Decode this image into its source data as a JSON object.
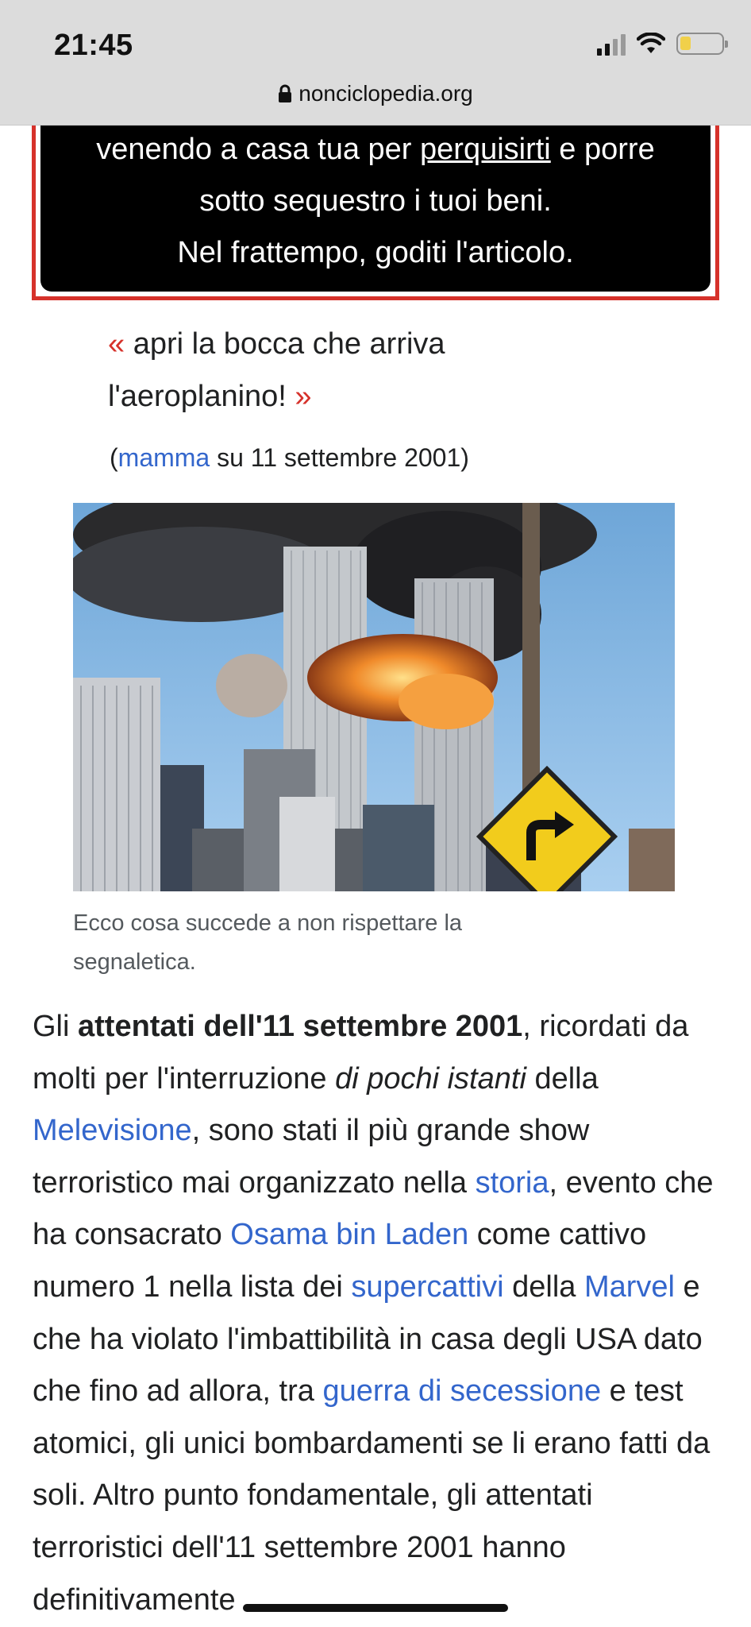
{
  "status_bar": {
    "time": "21:45"
  },
  "url_bar": {
    "domain": "nonciclopedia.org"
  },
  "warning": {
    "line1_before": "venendo a casa tua per ",
    "line1_link": "perquisirti",
    "line1_after": " e porre",
    "line2": "sotto sequestro i tuoi beni.",
    "line3": "Nel frattempo, goditi l'articolo."
  },
  "quote": {
    "open_mark": "«",
    "text": " apri la bocca che arriva l'aeroplanino! ",
    "close_mark": "»",
    "attr_open": "(",
    "attr_link": "mamma",
    "attr_rest": " su 11 settembre 2001)"
  },
  "figure": {
    "caption": "Ecco cosa succede a non rispettare la segnaletica."
  },
  "article": {
    "p1": "Gli ",
    "bold1": "attentati dell'11 settembre 2001",
    "p2": ", ricordati da molti per l'interruzione ",
    "italic1": "di pochi istanti",
    "p3": " della ",
    "link1": "Melevisione",
    "p4": ", sono stati il più grande show terroristico mai organizzato nella ",
    "link2": "storia",
    "p5": ", evento che ha consacrato ",
    "link3": "Osama bin Laden",
    "p6": " come cattivo numero 1 nella lista dei ",
    "link4": "supercattivi",
    "p7": " della ",
    "link5": "Marvel",
    "p8": " e che ha violato l'imbattibilità in casa degli USA dato che fino ad allora, tra ",
    "link6": "guerra di secessione",
    "p9": " e test atomici, gli unici bombardamenti se li erano fatti da soli. Altro punto fondamentale, gli attentati terroristici dell'11 settembre 2001 hanno definitivamente"
  },
  "colors": {
    "link": "#3366cc",
    "accent_red": "#d6322b",
    "warning_bg": "#000000"
  }
}
